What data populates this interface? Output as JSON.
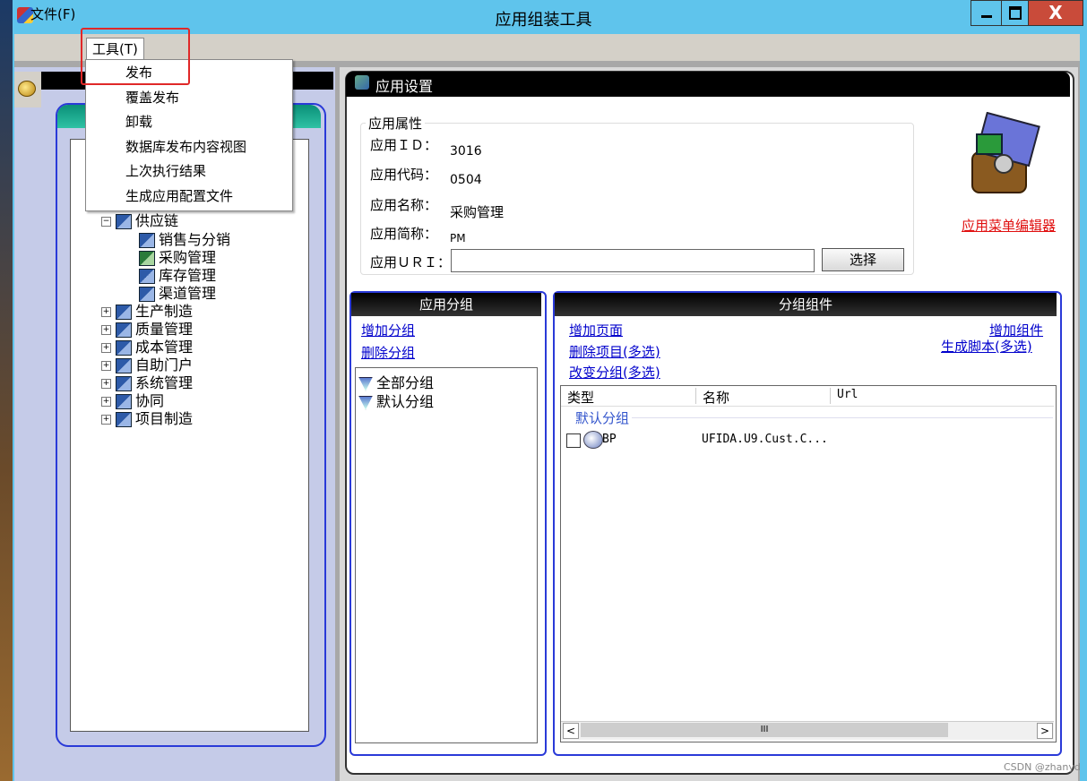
{
  "window": {
    "title": "应用组装工具",
    "close_glyph": "X"
  },
  "menubar": {
    "file": "文件(F)",
    "tools": "工具(T)"
  },
  "tools_menu": {
    "items": [
      "发布",
      "覆盖发布",
      "卸载",
      "数据库发布内容视图",
      "上次执行结果",
      "生成应用配置文件"
    ]
  },
  "tree": {
    "items": [
      {
        "label": "供应链",
        "expand": "−"
      },
      {
        "label": "销售与分销"
      },
      {
        "label": "采购管理"
      },
      {
        "label": "库存管理"
      },
      {
        "label": "渠道管理"
      },
      {
        "label": "生产制造",
        "expand": "+"
      },
      {
        "label": "质量管理",
        "expand": "+"
      },
      {
        "label": "成本管理",
        "expand": "+"
      },
      {
        "label": "自助门户",
        "expand": "+"
      },
      {
        "label": "系统管理",
        "expand": "+"
      },
      {
        "label": "协同",
        "expand": "+"
      },
      {
        "label": "项目制造",
        "expand": "+"
      }
    ]
  },
  "settings": {
    "title": "应用设置",
    "props_legend": "应用属性",
    "labels": {
      "id": "应用ＩＤ：",
      "code": "应用代码：",
      "name": "应用名称：",
      "short": "应用简称：",
      "uri": "应用ＵＲＩ："
    },
    "values": {
      "id": "3016",
      "code": "0504",
      "name": "采购管理",
      "short": "PM",
      "uri": ""
    },
    "select_button": "选择",
    "menu_editor_link": "应用菜单编辑器"
  },
  "groups": {
    "title": "应用分组",
    "add": "增加分组",
    "delete": "删除分组",
    "items": [
      "全部分组",
      "默认分组"
    ]
  },
  "components": {
    "title": "分组组件",
    "add_page": "增加页面",
    "delete_items": "删除项目(多选)",
    "change_group": "改变分组(多选)",
    "add_component": "增加组件",
    "gen_script": "生成脚本(多选)",
    "columns": [
      "类型",
      "名称",
      "Url"
    ],
    "group_label": "默认分组",
    "rows": [
      {
        "type": "BP",
        "name": "UFIDA.U9.Cust.C..."
      }
    ]
  },
  "scrollbar": {
    "left": "<",
    "thumb": "III",
    "right": ">"
  },
  "watermark": "CSDN @zhanyd"
}
